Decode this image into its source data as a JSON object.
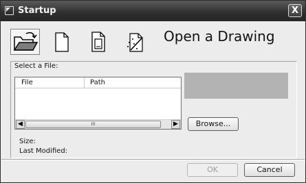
{
  "window": {
    "title": "Startup",
    "close_glyph": "X"
  },
  "toolbar": {
    "buttons": [
      {
        "name": "open-folder-icon",
        "selected": true
      },
      {
        "name": "new-drawing-icon",
        "selected": false
      },
      {
        "name": "template-icon",
        "selected": false
      },
      {
        "name": "wizard-icon",
        "selected": false
      }
    ],
    "heading": "Open a Drawing"
  },
  "file_group": {
    "label": "Select a File:",
    "columns": [
      "File",
      "Path"
    ],
    "scroll_thumb_grip": "III",
    "scroll_left_glyph": "◀",
    "scroll_right_glyph": "▶",
    "browse_label": "Browse...",
    "size_label": "Size:",
    "last_modified_label": "Last Modified:"
  },
  "footer": {
    "ok_label": "OK",
    "cancel_label": "Cancel"
  },
  "colors": {
    "title_bar": "#2e2e2e",
    "dialog_bg": "#ececec",
    "preview_bg": "#b3b3b3"
  }
}
